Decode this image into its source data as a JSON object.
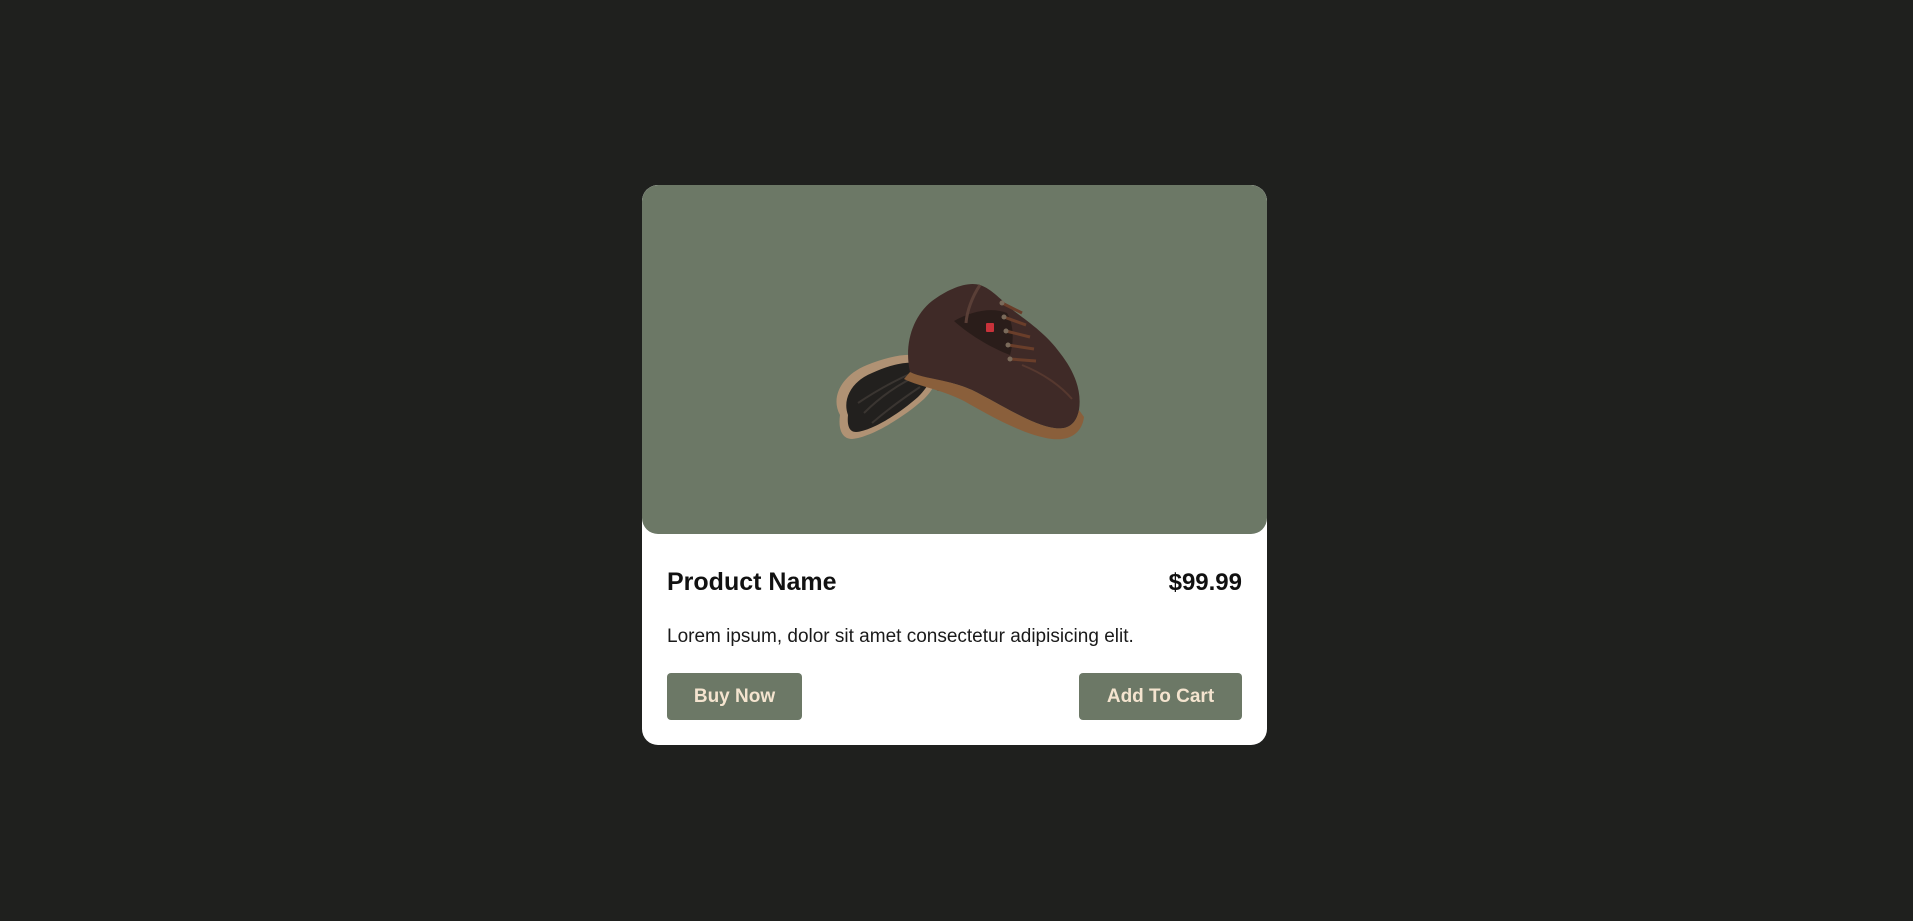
{
  "product": {
    "name": "Product Name",
    "price": "$99.99",
    "description": "Lorem ipsum, dolor sit amet consectetur adipisicing elit.",
    "image_icon": "shoe-icon"
  },
  "actions": {
    "buy_label": "Buy Now",
    "cart_label": "Add To Cart"
  },
  "colors": {
    "page_background": "#1f201e",
    "accent": "#6c7866",
    "button_text": "#f4e4cf",
    "card_background": "#ffffff"
  }
}
